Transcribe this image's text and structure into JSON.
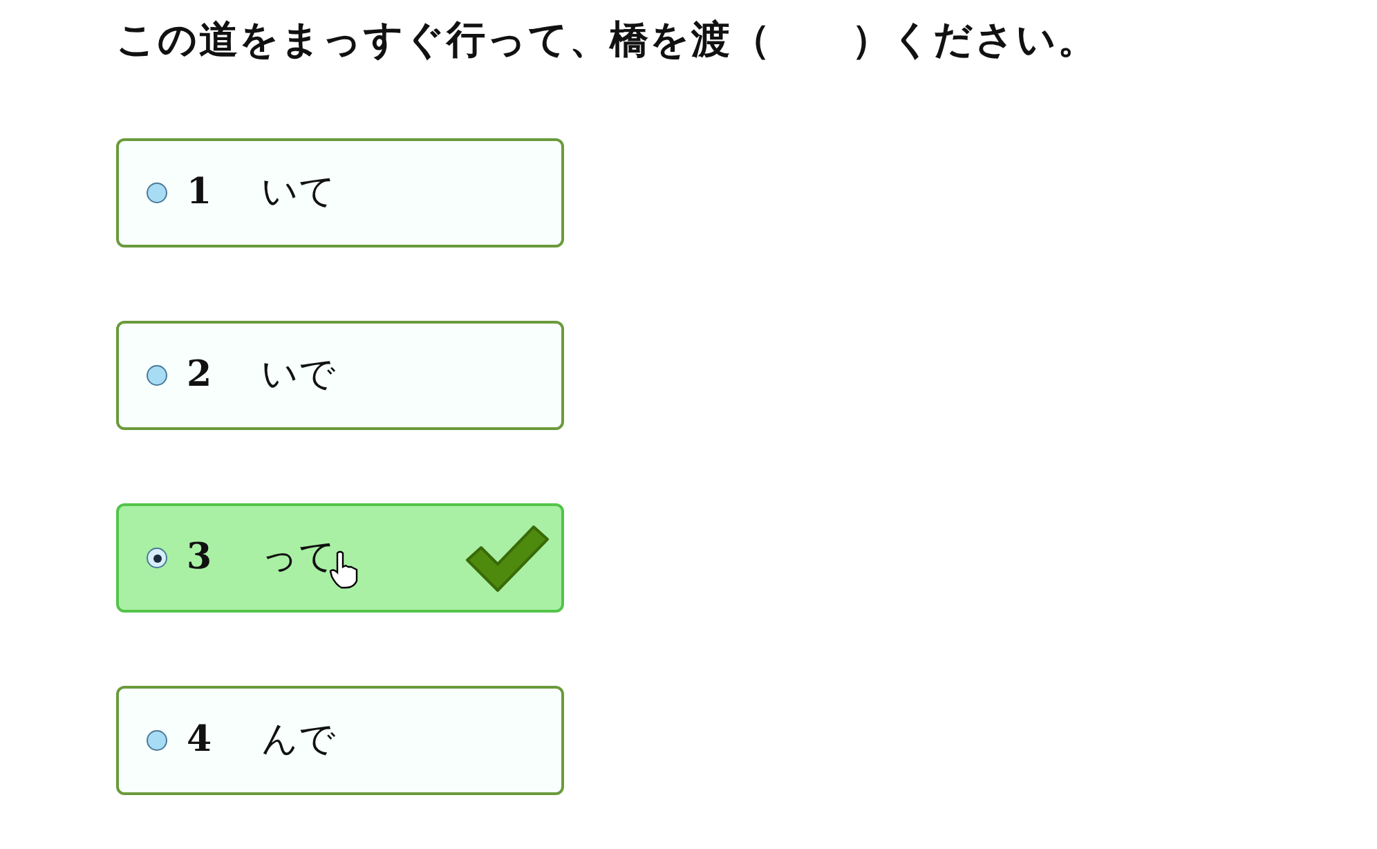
{
  "question": "この道をまっすぐ行って、橋を渡（　　）ください。",
  "options": [
    {
      "number": "1",
      "text": "いて",
      "selected": false,
      "correct": false
    },
    {
      "number": "2",
      "text": "いで",
      "selected": false,
      "correct": false
    },
    {
      "number": "3",
      "text": "って",
      "selected": true,
      "correct": true
    },
    {
      "number": "4",
      "text": "んで",
      "selected": false,
      "correct": false
    }
  ]
}
